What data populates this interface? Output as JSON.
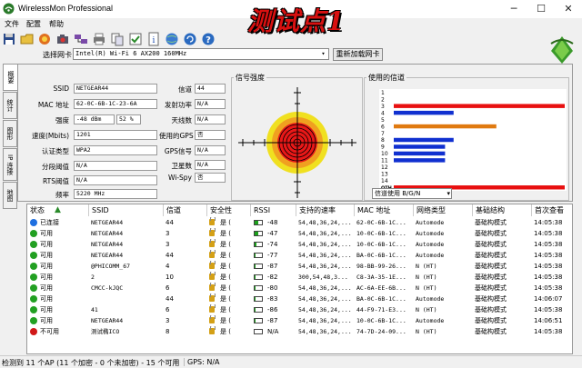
{
  "window": {
    "title": "WirelessMon Professional",
    "minimize": "─",
    "maximize": "☐",
    "close": "✕"
  },
  "overlay_title": "测试点1",
  "menu": [
    "文件",
    "配置",
    "帮助"
  ],
  "toolbar_icons": [
    "save-icon",
    "open-folder-icon",
    "record-icon",
    "camera-icon",
    "network-icon",
    "print-icon",
    "copy-icon",
    "check-icon",
    "info-icon",
    "globe-icon",
    "refresh-globe-icon",
    "help-icon"
  ],
  "adapter": {
    "label": "选择网卡",
    "value": "Intel(R) Wi-Fi 6 AX200 160MHz",
    "refresh_label": "重新加载网卡"
  },
  "tabs": [
    "概要",
    "统计",
    "图形",
    "IP 连接",
    "地图"
  ],
  "summary": {
    "fields_left": [
      {
        "label": "SSID",
        "value": "NETGEAR44"
      },
      {
        "label": "MAC 地址",
        "value": "62-0C-6B-1C-23-6A"
      },
      {
        "label": "强度",
        "value": "-48 dBm",
        "value2": "52 %"
      },
      {
        "label": "速度(Mbits)",
        "value": "1201"
      },
      {
        "label": "认证类型",
        "value": "WPA2"
      },
      {
        "label": "分段阈值",
        "value": "N/A"
      },
      {
        "label": "RTS阈值",
        "value": "N/A"
      },
      {
        "label": "频率",
        "value": "5220 MHz"
      }
    ],
    "fields_right": [
      {
        "label": "信道",
        "value": "44"
      },
      {
        "label": "发射功率",
        "value": "N/A"
      },
      {
        "label": "天线数",
        "value": "N/A"
      },
      {
        "label": "使用的GPS",
        "value": "否"
      },
      {
        "label": "GPS信号",
        "value": "N/A"
      },
      {
        "label": "卫星数",
        "value": "N/A"
      },
      {
        "label": "Wi-Spy",
        "value": "否"
      }
    ],
    "signal_label": "信号强度",
    "channels_label": "使用的信道",
    "band_select": "信道使用 B/G/N"
  },
  "chart_data": {
    "type": "bar",
    "title": "使用的信道",
    "orientation": "horizontal",
    "categories": [
      "1",
      "2",
      "3",
      "4",
      "5",
      "6",
      "7",
      "8",
      "9",
      "10",
      "11",
      "12",
      "13",
      "14",
      "OTH"
    ],
    "series": [
      {
        "color": "#e81010",
        "values": [
          0,
          0,
          1,
          0,
          0,
          0,
          0,
          0,
          0,
          0,
          0,
          0,
          0,
          0,
          1
        ]
      },
      {
        "color": "#1030d0",
        "values": [
          0,
          0,
          0,
          0.35,
          0,
          0,
          0,
          0.35,
          0,
          0,
          0,
          0,
          0,
          0,
          0
        ]
      },
      {
        "color": "#e07a10",
        "values": [
          0,
          0,
          0,
          0,
          0,
          0.6,
          0,
          0,
          0,
          0,
          0,
          0,
          0,
          0,
          0
        ]
      },
      {
        "color": "#1030d0",
        "values": [
          0,
          0,
          0,
          0,
          0,
          0,
          0,
          0,
          0.3,
          0.3,
          0.3,
          0,
          0,
          0,
          0
        ]
      }
    ]
  },
  "table": {
    "columns": [
      "状态",
      "SSID",
      "信道",
      "安全性",
      "RSSI",
      "支持的速率",
      "MAC 地址",
      "网络类型",
      "基础结构",
      "首次查看"
    ],
    "rows": [
      {
        "status": "已连接",
        "status_color": "#1e6fe0",
        "ssid": "NETGEAR44",
        "channel": "44",
        "security": "是 (",
        "rssi": "-48",
        "rssi_fill": 0.55,
        "rates": "54,48,36,24,...",
        "mac": "62-0C-6B-1C...",
        "type": "Automode",
        "infra": "基础构模式",
        "first": "14:05:38"
      },
      {
        "status": "可用",
        "status_color": "#22a022",
        "ssid": "NETGEAR44",
        "channel": "3",
        "security": "是 (",
        "rssi": "-47",
        "rssi_fill": 0.55,
        "rates": "54,48,36,24,...",
        "mac": "10-0C-6B-1C...",
        "type": "Automode",
        "infra": "基础构模式",
        "first": "14:05:38"
      },
      {
        "status": "可用",
        "status_color": "#22a022",
        "ssid": "NETGEAR44",
        "channel": "3",
        "security": "是 (",
        "rssi": "-74",
        "rssi_fill": 0.2,
        "rates": "54,48,36,24,...",
        "mac": "10-0C-6B-1C...",
        "type": "Automode",
        "infra": "基础构模式",
        "first": "14:05:38"
      },
      {
        "status": "可用",
        "status_color": "#22a022",
        "ssid": "NETGEAR44",
        "channel": "44",
        "security": "是 (",
        "rssi": "-77",
        "rssi_fill": 0.15,
        "rates": "54,48,36,24,...",
        "mac": "BA-0C-6B-1C...",
        "type": "Automode",
        "infra": "基础构模式",
        "first": "14:05:38"
      },
      {
        "status": "可用",
        "status_color": "#22a022",
        "ssid": "@PHICOMM_67",
        "channel": "4",
        "security": "是 (",
        "rssi": "-87",
        "rssi_fill": 0.05,
        "rates": "54,48,36,24,...",
        "mac": "98-BB-99-26...",
        "type": "N (HT)",
        "infra": "基础构模式",
        "first": "14:05:38"
      },
      {
        "status": "可用",
        "status_color": "#22a022",
        "ssid": "2",
        "channel": "10",
        "security": "是 (",
        "rssi": "-82",
        "rssi_fill": 0.1,
        "rates": "300,54,48,3...",
        "mac": "C8-3A-35-1E...",
        "type": "N (HT)",
        "infra": "基础构模式",
        "first": "14:05:38"
      },
      {
        "status": "可用",
        "status_color": "#22a022",
        "ssid": "CMCC-kJQC",
        "channel": "6",
        "security": "是 (",
        "rssi": "-80",
        "rssi_fill": 0.1,
        "rates": "54,48,36,24,...",
        "mac": "AC-6A-EE-6B...",
        "type": "N (HT)",
        "infra": "基础构模式",
        "first": "14:05:38"
      },
      {
        "status": "可用",
        "status_color": "#22a022",
        "ssid": "",
        "channel": "44",
        "security": "是 (",
        "rssi": "-83",
        "rssi_fill": 0.1,
        "rates": "54,48,36,24,...",
        "mac": "BA-0C-6B-1C...",
        "type": "Automode",
        "infra": "基础构模式",
        "first": "14:06:07"
      },
      {
        "status": "可用",
        "status_color": "#22a022",
        "ssid": "41",
        "channel": "6",
        "security": "是 (",
        "rssi": "-86",
        "rssi_fill": 0.05,
        "rates": "54,48,36,24,...",
        "mac": "44-F9-71-E3...",
        "type": "N (HT)",
        "infra": "基础构模式",
        "first": "14:05:38"
      },
      {
        "status": "可用",
        "status_color": "#22a022",
        "ssid": "NETGEAR44",
        "channel": "3",
        "security": "是 (",
        "rssi": "-87",
        "rssi_fill": 0.05,
        "rates": "54,48,36,24,...",
        "mac": "10-0C-6B-1C...",
        "type": "Automode",
        "infra": "基础构模式",
        "first": "14:06:51"
      },
      {
        "status": "不可用",
        "status_color": "#d01818",
        "ssid": "测试椭ICO",
        "channel": "8",
        "security": "是 (",
        "rssi": "N/A",
        "rssi_fill": 0,
        "rates": "54,48,36,24,...",
        "mac": "74-7D-24-09...",
        "type": "N (HT)",
        "infra": "基础构模式",
        "first": "14:05:38"
      }
    ]
  },
  "statusbar": {
    "left": "检测到 11 个AP (11 个加密 - 0 个未加密) - 15 个可用",
    "right": "GPS: N/A"
  }
}
